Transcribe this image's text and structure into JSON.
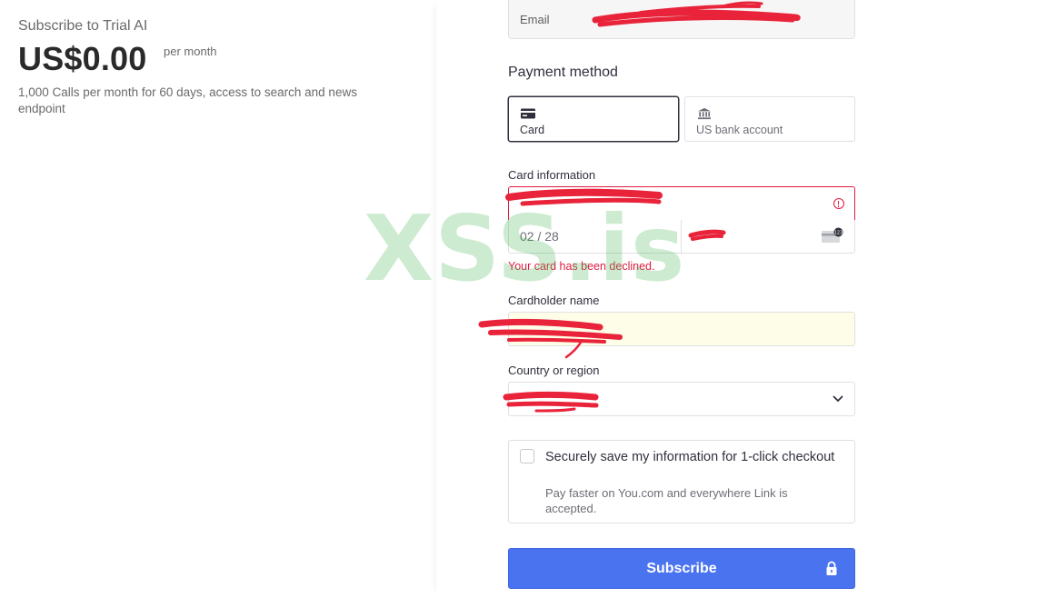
{
  "summary": {
    "product_name": "Subscribe to Trial AI",
    "price": "US$0.00",
    "price_period": "per month",
    "description": "1,000 Calls per month for 60 days, access to search and news endpoint"
  },
  "form": {
    "email_label": "Email",
    "payment_method_title": "Payment method",
    "payment_methods": [
      {
        "label": "Card",
        "icon": "card-icon",
        "selected": true
      },
      {
        "label": "US bank account",
        "icon": "bank-icon",
        "selected": false
      }
    ],
    "card_info_label": "Card information",
    "expiry_value": "02 / 28",
    "card_error": "Your card has been declined.",
    "cardholder_label": "Cardholder name",
    "country_label": "Country or region",
    "save_title": "Securely save my information for 1-click checkout",
    "save_subtitle": "Pay faster on You.com and everywhere Link is accepted.",
    "save_checked": false,
    "subscribe_label": "Subscribe"
  },
  "colors": {
    "accent": "#4a73f0",
    "error": "#df1b41",
    "autofill": "#fefde8",
    "redaction": "#e8233a"
  },
  "watermark": "XSS.is"
}
